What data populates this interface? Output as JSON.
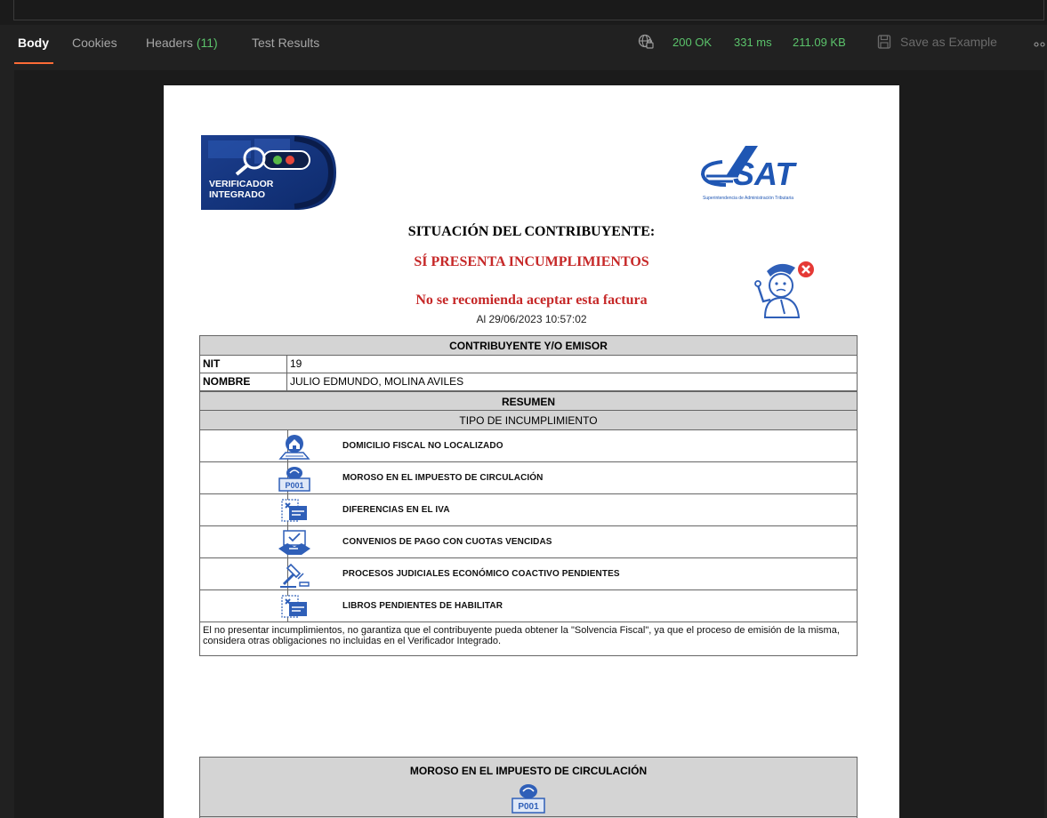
{
  "response_tabs": {
    "body": "Body",
    "cookies": "Cookies",
    "headers": "Headers",
    "headers_count": "(11)",
    "test_results": "Test Results"
  },
  "status": {
    "code": "200 OK",
    "time": "331 ms",
    "size": "211.09 KB",
    "save_label": "Save as Example"
  },
  "colors": {
    "accent": "#ff6c37",
    "success": "#5bc36b",
    "danger": "#c62828"
  },
  "document": {
    "vi_logo_text": [
      "VERIFICADOR",
      "INTEGRADO"
    ],
    "sat_logo_text": "SAT",
    "sat_logo_subtitle": "Superintendencia de Administración Tributaria",
    "title": "SITUACIÓN DEL CONTRIBUYENTE:",
    "status": "SÍ PRESENTA INCUMPLIMIENTOS",
    "warning": "No se recomienda aceptar esta factura",
    "date": "Al 29/06/2023 10:57:02",
    "taxpayer_header": "CONTRIBUYENTE Y/O EMISOR",
    "nit_label": "NIT",
    "nit_value": "19",
    "name_label": "NOMBRE",
    "name_value": "JULIO EDMUNDO, MOLINA AVILES",
    "summary_header": "RESUMEN",
    "type_header": "TIPO DE INCUMPLIMIENTO",
    "incumplimientos": [
      {
        "label": "DOMICILIO FISCAL NO LOCALIZADO",
        "icon": "house-location-icon"
      },
      {
        "label": "MOROSO EN EL IMPUESTO DE CIRCULACIÓN",
        "icon": "vehicle-tax-icon"
      },
      {
        "label": "DIFERENCIAS EN EL IVA",
        "icon": "invoice-error-icon"
      },
      {
        "label": "CONVENIOS DE PAGO CON CUOTAS VENCIDAS",
        "icon": "handshake-agreement-icon"
      },
      {
        "label": "PROCESOS JUDICIALES ECONÓMICO COACTIVO PENDIENTES",
        "icon": "gavel-icon"
      },
      {
        "label": "LIBROS PENDIENTES DE HABILITAR",
        "icon": "invoice-error-icon"
      }
    ],
    "note": "El no presentar incumplimientos, no garantiza que el contribuyente pueda obtener la \"Solvencia Fiscal\", ya que el proceso de emisión de la misma, considera otras obligaciones no incluidas en el Verificador Integrado.",
    "second_table_title": "MOROSO EN EL IMPUESTO DE CIRCULACIÓN"
  }
}
